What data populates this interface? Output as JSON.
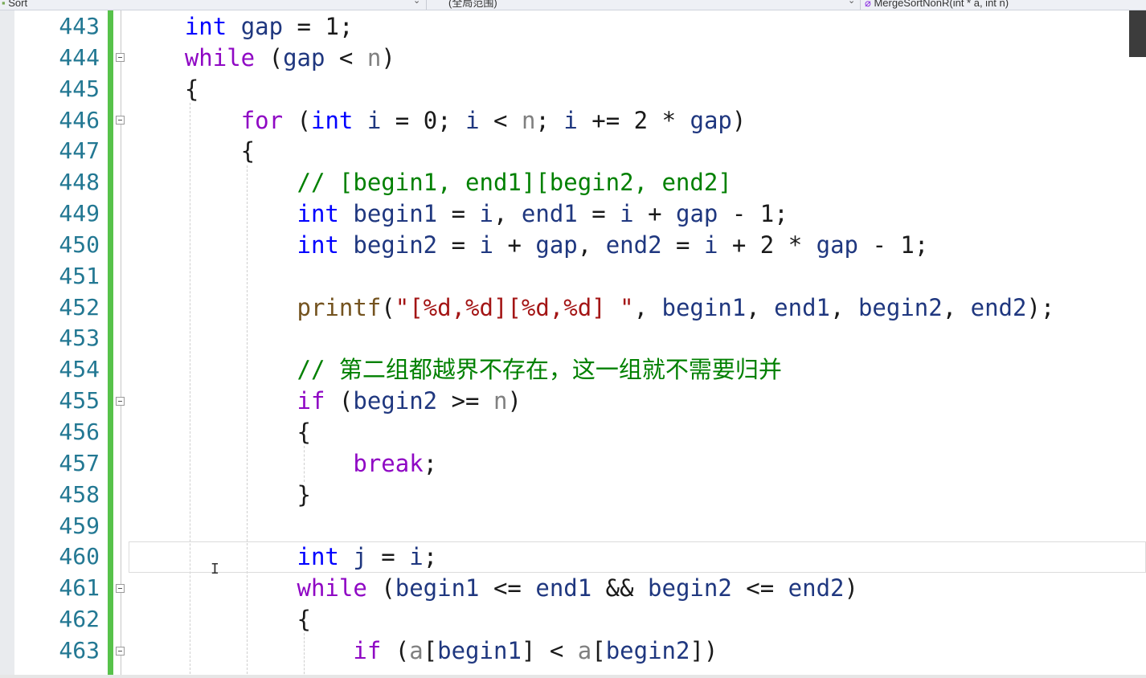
{
  "navbar": {
    "project": "Sort",
    "scope": "(全局范围)",
    "function": "MergeSortNonR(int * a, int n)"
  },
  "line_numbers": [
    "443",
    "444",
    "445",
    "446",
    "447",
    "448",
    "449",
    "450",
    "451",
    "452",
    "453",
    "454",
    "455",
    "456",
    "457",
    "458",
    "459",
    "460",
    "461",
    "462",
    "463"
  ],
  "code_lines": [
    [
      [
        "t",
        "    "
      ],
      [
        "kw",
        "int"
      ],
      [
        "t",
        " "
      ],
      [
        "id",
        "gap"
      ],
      [
        "t",
        " = "
      ],
      [
        "t",
        "1"
      ],
      [
        "t",
        ";"
      ]
    ],
    [
      [
        "t",
        "    "
      ],
      [
        "kw2",
        "while"
      ],
      [
        "t",
        " ("
      ],
      [
        "id",
        "gap"
      ],
      [
        "t",
        " < "
      ],
      [
        "prm",
        "n"
      ],
      [
        "t",
        ")"
      ]
    ],
    [
      [
        "t",
        "    {"
      ]
    ],
    [
      [
        "t",
        "        "
      ],
      [
        "kw2",
        "for"
      ],
      [
        "t",
        " ("
      ],
      [
        "kw",
        "int"
      ],
      [
        "t",
        " "
      ],
      [
        "id",
        "i"
      ],
      [
        "t",
        " = 0; "
      ],
      [
        "id",
        "i"
      ],
      [
        "t",
        " < "
      ],
      [
        "prm",
        "n"
      ],
      [
        "t",
        "; "
      ],
      [
        "id",
        "i"
      ],
      [
        "t",
        " += 2 * "
      ],
      [
        "id",
        "gap"
      ],
      [
        "t",
        ")"
      ]
    ],
    [
      [
        "t",
        "        {"
      ]
    ],
    [
      [
        "t",
        "            "
      ],
      [
        "cm",
        "// [begin1, end1][begin2, end2]"
      ]
    ],
    [
      [
        "t",
        "            "
      ],
      [
        "kw",
        "int"
      ],
      [
        "t",
        " "
      ],
      [
        "id",
        "begin1"
      ],
      [
        "t",
        " = "
      ],
      [
        "id",
        "i"
      ],
      [
        "t",
        ", "
      ],
      [
        "id",
        "end1"
      ],
      [
        "t",
        " = "
      ],
      [
        "id",
        "i"
      ],
      [
        "t",
        " + "
      ],
      [
        "id",
        "gap"
      ],
      [
        "t",
        " - 1;"
      ]
    ],
    [
      [
        "t",
        "            "
      ],
      [
        "kw",
        "int"
      ],
      [
        "t",
        " "
      ],
      [
        "id",
        "begin2"
      ],
      [
        "t",
        " = "
      ],
      [
        "id",
        "i"
      ],
      [
        "t",
        " + "
      ],
      [
        "id",
        "gap"
      ],
      [
        "t",
        ", "
      ],
      [
        "id",
        "end2"
      ],
      [
        "t",
        " = "
      ],
      [
        "id",
        "i"
      ],
      [
        "t",
        " + 2 * "
      ],
      [
        "id",
        "gap"
      ],
      [
        "t",
        " - 1;"
      ]
    ],
    [],
    [
      [
        "t",
        "            "
      ],
      [
        "fn",
        "printf"
      ],
      [
        "t",
        "("
      ],
      [
        "str",
        "\"[%d,%d][%d,%d] \""
      ],
      [
        "t",
        ", "
      ],
      [
        "id",
        "begin1"
      ],
      [
        "t",
        ", "
      ],
      [
        "id",
        "end1"
      ],
      [
        "t",
        ", "
      ],
      [
        "id",
        "begin2"
      ],
      [
        "t",
        ", "
      ],
      [
        "id",
        "end2"
      ],
      [
        "t",
        ");"
      ]
    ],
    [],
    [
      [
        "t",
        "            "
      ],
      [
        "cm",
        "// "
      ],
      [
        "cmcn",
        "第二组都越界不存在，这一组就不需要归并"
      ]
    ],
    [
      [
        "t",
        "            "
      ],
      [
        "kw2",
        "if"
      ],
      [
        "t",
        " ("
      ],
      [
        "id",
        "begin2"
      ],
      [
        "t",
        " >= "
      ],
      [
        "prm",
        "n"
      ],
      [
        "t",
        ")"
      ]
    ],
    [
      [
        "t",
        "            {"
      ]
    ],
    [
      [
        "t",
        "                "
      ],
      [
        "kw2",
        "break"
      ],
      [
        "t",
        ";"
      ]
    ],
    [
      [
        "t",
        "            }"
      ]
    ],
    [],
    [
      [
        "t",
        "            "
      ],
      [
        "kw",
        "int"
      ],
      [
        "t",
        " "
      ],
      [
        "id",
        "j"
      ],
      [
        "t",
        " = "
      ],
      [
        "id",
        "i"
      ],
      [
        "t",
        ";"
      ]
    ],
    [
      [
        "t",
        "            "
      ],
      [
        "kw2",
        "while"
      ],
      [
        "t",
        " ("
      ],
      [
        "id",
        "begin1"
      ],
      [
        "t",
        " <= "
      ],
      [
        "id",
        "end1"
      ],
      [
        "t",
        " && "
      ],
      [
        "id",
        "begin2"
      ],
      [
        "t",
        " <= "
      ],
      [
        "id",
        "end2"
      ],
      [
        "t",
        ")"
      ]
    ],
    [
      [
        "t",
        "            {"
      ]
    ],
    [
      [
        "t",
        "                "
      ],
      [
        "kw2",
        "if"
      ],
      [
        "t",
        " ("
      ],
      [
        "prm",
        "a"
      ],
      [
        "t",
        "["
      ],
      [
        "id",
        "begin1"
      ],
      [
        "t",
        "] < "
      ],
      [
        "prm",
        "a"
      ],
      [
        "t",
        "["
      ],
      [
        "id",
        "begin2"
      ],
      [
        "t",
        "])"
      ]
    ]
  ],
  "current_line": "460",
  "colors": {
    "keyword": "#0000ff",
    "control_keyword": "#8f08c4",
    "identifier": "#1f377f",
    "parameter": "#808080",
    "string": "#a31515",
    "function": "#74531f",
    "comment": "#008000",
    "line_number": "#237893",
    "change_bar": "#57c24a"
  }
}
